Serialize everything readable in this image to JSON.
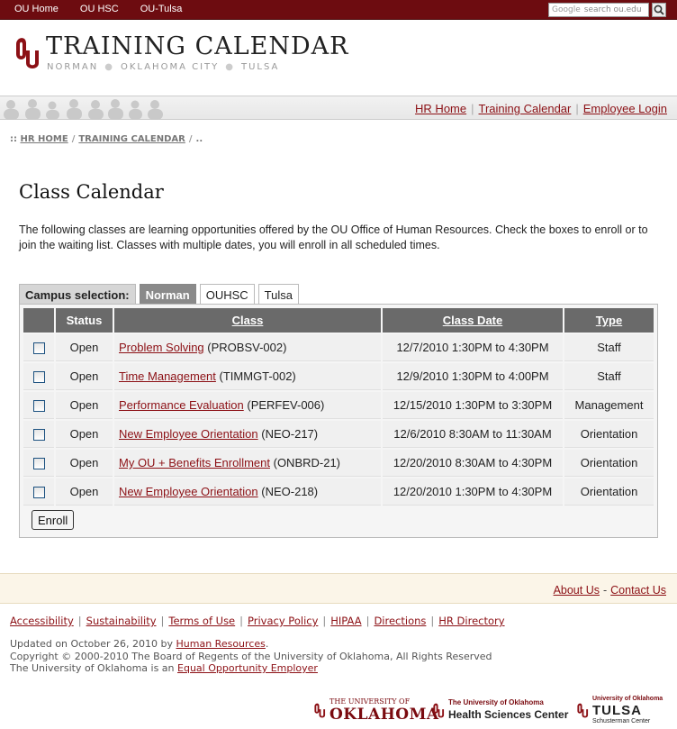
{
  "topbar": {
    "links": [
      "OU Home",
      "OU HSC",
      "OU-Tulsa"
    ],
    "search_brand": "Google",
    "search_placeholder": "search ou.edu"
  },
  "header": {
    "title": "TRAINING CALENDAR",
    "campuses": [
      "NORMAN",
      "OKLAHOMA CITY",
      "TULSA"
    ]
  },
  "nav": {
    "links": [
      "HR Home",
      "Training Calendar",
      "Employee Login"
    ]
  },
  "breadcrumb": {
    "prefix": "::",
    "items": [
      "HR HOME",
      "TRAINING CALENDAR"
    ],
    "tail": ".."
  },
  "page": {
    "title": "Class Calendar",
    "intro": "The following classes are learning opportunities offered by the OU Office of Human Resources. Check the boxes to enroll or to join the waiting list. Classes with multiple dates, you will enroll in all scheduled times."
  },
  "campus": {
    "label": "Campus selection:",
    "tabs": [
      "Norman",
      "OUHSC",
      "Tulsa"
    ],
    "selected": "Norman"
  },
  "table": {
    "headers": {
      "status": "Status",
      "class": "Class",
      "date": "Class Date",
      "type": "Type"
    },
    "rows": [
      {
        "status": "Open",
        "name": "Problem Solving",
        "code": "(PROBSV-002)",
        "date": "12/7/2010 1:30PM to 4:30PM",
        "type": "Staff"
      },
      {
        "status": "Open",
        "name": "Time Management",
        "code": "(TIMMGT-002)",
        "date": "12/9/2010 1:30PM to 4:00PM",
        "type": "Staff"
      },
      {
        "status": "Open",
        "name": "Performance Evaluation",
        "code": "(PERFEV-006)",
        "date": "12/15/2010 1:30PM to 3:30PM",
        "type": "Management"
      },
      {
        "status": "Open",
        "name": "New Employee Orientation",
        "code": "(NEO-217)",
        "date": "12/6/2010 8:30AM to 11:30AM",
        "type": "Orientation"
      },
      {
        "status": "Open",
        "name": "My OU + Benefits Enrollment",
        "code": "(ONBRD-21)",
        "date": "12/20/2010 8:30AM to 4:30PM",
        "type": "Orientation"
      },
      {
        "status": "Open",
        "name": "New Employee Orientation",
        "code": "(NEO-218)",
        "date": "12/20/2010 1:30PM to 4:30PM",
        "type": "Orientation"
      }
    ],
    "enroll_label": "Enroll"
  },
  "footer": {
    "about": "About Us",
    "contact": "Contact Us",
    "dash": "-",
    "links": [
      "Accessibility",
      "Sustainability",
      "Terms of Use",
      "Privacy Policy",
      "HIPAA",
      "Directions",
      "HR Directory"
    ],
    "updated_prefix": "Updated on October 26, 2010 by",
    "updated_link": "Human Resources",
    "copyright": "Copyright © 2000-2010 The Board of Regents of the University of Oklahoma, All Rights Reserved",
    "eoe_prefix": "The University of Oklahoma is an",
    "eoe_link": "Equal Opportunity Employer"
  },
  "logos": {
    "ou": {
      "small": "THE UNIVERSITY OF",
      "big": "OKLAHOMA"
    },
    "hsc": {
      "small": "The University of Oklahoma",
      "big": "Health Sciences Center"
    },
    "tulsa": {
      "small": "University of Oklahoma",
      "big": "TULSA",
      "tiny": "Schusterman Center"
    }
  },
  "colors": {
    "crimson": "#8c1015",
    "topbar": "#6d0c10"
  }
}
